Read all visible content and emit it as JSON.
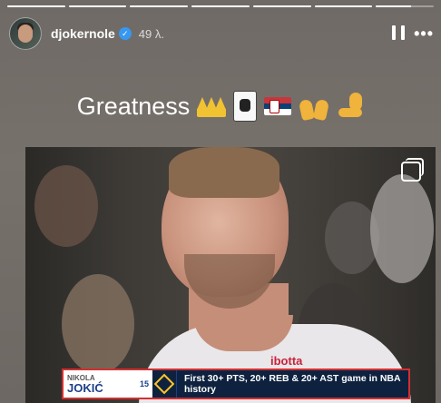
{
  "story": {
    "progress": [
      1,
      1,
      1,
      1,
      1,
      1,
      0.6
    ],
    "username": "djokernole",
    "verified_mark": "✓",
    "time_ago": "49 λ.",
    "caption": "Greatness",
    "emojis": [
      "crown",
      "joker-card",
      "serbia-flag",
      "raising-hands",
      "flexed-biceps"
    ]
  },
  "photo": {
    "sponsor": "ibotta",
    "lower_third": {
      "first_name": "NIKOLA",
      "last_name": "JOKIĆ",
      "number": "15",
      "stat_text": "First 30+ PTS, 20+ REB & 20+ AST game in NBA history"
    }
  },
  "colors": {
    "accent_red": "#d32f2f",
    "nuggets_navy": "#0e2240",
    "nuggets_gold": "#fec524"
  }
}
